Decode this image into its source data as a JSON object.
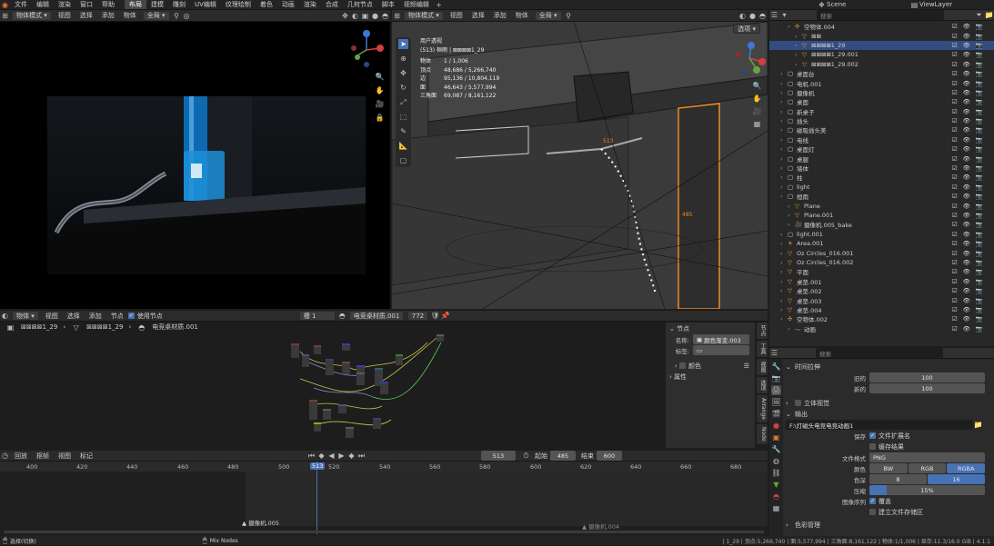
{
  "menu": {
    "items": [
      "文件",
      "编辑",
      "渲染",
      "窗口",
      "帮助"
    ],
    "workspaces": [
      "布局",
      "建模",
      "雕刻",
      "UV编辑",
      "纹理绘制",
      "着色",
      "动画",
      "渲染",
      "合成",
      "几何节点",
      "脚本",
      "视频编辑"
    ],
    "active_workspace": "布局",
    "scene": "Scene",
    "view_layer": "ViewLayer"
  },
  "left_viewport": {
    "mode": "物体模式",
    "menus": [
      "视图",
      "选择",
      "添加",
      "物体"
    ],
    "transform": "全局"
  },
  "main_viewport": {
    "mode": "物体模式",
    "menus": [
      "视图",
      "选择",
      "添加",
      "物体"
    ],
    "transform": "全局",
    "options": "选项",
    "overlay": {
      "title": "用户透视",
      "collection": "(513) 桓雨 | ⊠⊠⊠⊠1_29",
      "stats": [
        {
          "label": "物体",
          "value": "1 / 1,006"
        },
        {
          "label": "顶点",
          "value": "48,686 / 5,266,740"
        },
        {
          "label": "边",
          "value": "95,136 / 10,804,119"
        },
        {
          "label": "面",
          "value": "46,643 / 5,577,994"
        },
        {
          "label": "三角面",
          "value": "69,087 / 8,161,122"
        }
      ]
    },
    "path_labels": [
      "513",
      "485"
    ]
  },
  "outliner": {
    "search_placeholder": "搜索",
    "rows": [
      {
        "indent": 2,
        "name": "空物体.004",
        "icon": "empty-icon",
        "sel": false
      },
      {
        "indent": 3,
        "name": "⊠⊠",
        "icon": "mesh-icon",
        "sel": false
      },
      {
        "indent": 3,
        "name": "⊠⊠⊠⊠1_29",
        "icon": "mesh-icon",
        "sel": true
      },
      {
        "indent": 3,
        "name": "⊠⊠⊠⊠1_29.001",
        "icon": "mesh-icon",
        "sel": false
      },
      {
        "indent": 3,
        "name": "⊠⊠⊠⊠1_29.002",
        "icon": "mesh-icon",
        "sel": false
      },
      {
        "indent": 1,
        "name": "桌面台",
        "icon": "collection-icon",
        "sel": false
      },
      {
        "indent": 1,
        "name": "电机.001",
        "icon": "collection-icon",
        "sel": false
      },
      {
        "indent": 1,
        "name": "摄像机",
        "icon": "collection-icon",
        "sel": false
      },
      {
        "indent": 1,
        "name": "桌面",
        "icon": "collection-icon",
        "sel": false
      },
      {
        "indent": 1,
        "name": "新桌子",
        "icon": "collection-icon",
        "sel": false
      },
      {
        "indent": 1,
        "name": "插头",
        "icon": "collection-icon",
        "sel": false
      },
      {
        "indent": 1,
        "name": "磁吸插头美",
        "icon": "collection-icon",
        "sel": false
      },
      {
        "indent": 1,
        "name": "电线",
        "icon": "collection-icon",
        "sel": false
      },
      {
        "indent": 1,
        "name": "桌面灯",
        "icon": "collection-icon",
        "sel": false
      },
      {
        "indent": 1,
        "name": "桌腿",
        "icon": "collection-icon",
        "sel": false
      },
      {
        "indent": 1,
        "name": "墙体",
        "icon": "collection-icon",
        "sel": false
      },
      {
        "indent": 1,
        "name": "柱",
        "icon": "collection-icon",
        "sel": false
      },
      {
        "indent": 1,
        "name": "light",
        "icon": "collection-icon",
        "sel": false
      },
      {
        "indent": 1,
        "name": "桓雨",
        "icon": "collection-icon",
        "sel": false
      },
      {
        "indent": 2,
        "name": "Plane",
        "icon": "mesh-icon",
        "sel": false
      },
      {
        "indent": 2,
        "name": "Plane.001",
        "icon": "mesh-icon",
        "sel": false
      },
      {
        "indent": 2,
        "name": "摄像机.005_bake",
        "icon": "camera-icon",
        "sel": false
      },
      {
        "indent": 1,
        "name": "light.001",
        "icon": "collection-icon",
        "sel": false
      },
      {
        "indent": 1,
        "name": "Area.001",
        "icon": "light-icon",
        "sel": false
      },
      {
        "indent": 1,
        "name": "Oz Circles_016.001",
        "icon": "mesh-icon",
        "sel": false
      },
      {
        "indent": 1,
        "name": "Oz Circles_016.002",
        "icon": "mesh-icon",
        "sel": false
      },
      {
        "indent": 1,
        "name": "平面",
        "icon": "mesh-icon",
        "sel": false
      },
      {
        "indent": 1,
        "name": "桌垫.001",
        "icon": "mesh-icon",
        "sel": false
      },
      {
        "indent": 1,
        "name": "桌垫.002",
        "icon": "mesh-icon",
        "sel": false
      },
      {
        "indent": 1,
        "name": "桌垫.003",
        "icon": "mesh-icon",
        "sel": false
      },
      {
        "indent": 1,
        "name": "桌垫.004",
        "icon": "mesh-icon",
        "sel": false
      },
      {
        "indent": 1,
        "name": "空物体.002",
        "icon": "empty-icon",
        "sel": false
      },
      {
        "indent": 2,
        "name": "动画",
        "icon": "action-icon",
        "sel": false
      }
    ]
  },
  "properties": {
    "search_placeholder": "搜索",
    "time_stretch": {
      "title": "时间拉伸",
      "old_label": "旧的",
      "old_value": "100",
      "new_label": "新的",
      "new_value": "100"
    },
    "stereoscopy": "立体视觉",
    "output": {
      "title": "输出",
      "path": "F:\\灯磁头电竞电竞动画1",
      "save_label": "保存",
      "file_ext": "文件扩展名",
      "cache": "缓存结果",
      "format_label": "文件格式",
      "format": "PNG",
      "color_label": "颜色",
      "color_opts": [
        "BW",
        "RGB",
        "RGBA"
      ],
      "depth_label": "色深",
      "depth_opts": [
        "8",
        "16"
      ],
      "compress_label": "压缩",
      "compress": "15%",
      "seq_label": "图像序列",
      "overwrite": "覆盖",
      "placeholders": "建立文件存储区",
      "color_mgmt": "色彩管理"
    }
  },
  "node_editor": {
    "type": "物体",
    "menus": [
      "视图",
      "选择",
      "添加",
      "节点"
    ],
    "use_nodes": "使用节点",
    "slot": "槽 1",
    "material": "电竞桌材质.001",
    "users": "772",
    "breadcrumb": [
      "⊠⊠⊠⊠1_29",
      "⊠⊠⊠⊠1_29",
      "电竞桌材质.001"
    ],
    "side_tabs": [
      "节点",
      "工具",
      "视图",
      "选项",
      "Arrange",
      "Node"
    ],
    "panel": {
      "title": "节点",
      "name_label": "名称:",
      "name_value": "颜色渐变.003",
      "label_label": "标签:",
      "color_section": "颜色",
      "props_section": "属性"
    }
  },
  "timeline": {
    "menus": [
      "回放",
      "抠帧",
      "视图",
      "标记"
    ],
    "current": "513",
    "start_label": "起始",
    "start": "485",
    "end_label": "结束",
    "end": "600",
    "ticks": [
      "400",
      "420",
      "440",
      "460",
      "480",
      "500",
      "513",
      "520",
      "540",
      "560",
      "580",
      "600",
      "620",
      "640",
      "660",
      "680"
    ],
    "markers": [
      "摄像机.005",
      "摄像机.004"
    ]
  },
  "status": {
    "left": "选择(切换)",
    "middle": "Mix Nodes",
    "stats": "| 1_29 | 顶点:5,266,740 | 面:5,577,994 | 三角面:8,161,122 | 物体:1/1,006 | 显存:11.3/16.0 GiB | 4.1.1"
  }
}
